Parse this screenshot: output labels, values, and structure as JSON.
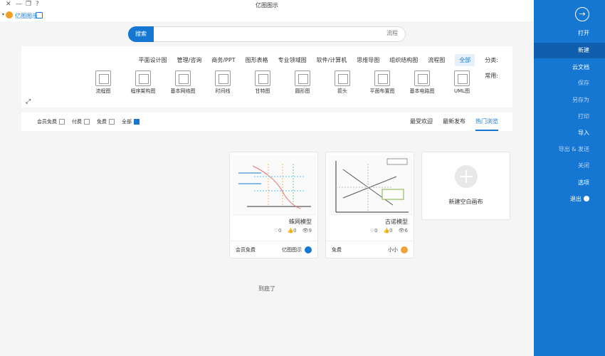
{
  "window": {
    "title": "亿图图示",
    "controls": [
      "✕",
      "—",
      "❐",
      "?"
    ]
  },
  "appbar": {
    "name": "亿图图示"
  },
  "search": {
    "button": "搜索",
    "placeholder": "流程"
  },
  "categories": {
    "label": "分类:",
    "items": [
      "全部",
      "流程图",
      "组织结构图",
      "思维导图",
      "软件/计算机",
      "专业领域图",
      "图形表格",
      "商务/PPT",
      "管理/咨询",
      "平面设计图"
    ],
    "active": 0
  },
  "common": {
    "label": "常用:",
    "items": [
      "UML图",
      "基本电路图",
      "平面布置图",
      "箭头",
      "圆形图",
      "甘特图",
      "时间线",
      "基本网络图",
      "程序架构图",
      "流程图"
    ]
  },
  "sort": {
    "tabs": [
      "热门浏览",
      "最新发布",
      "最受欢迎"
    ],
    "active": 0
  },
  "filters": [
    {
      "label": "全部",
      "checked": true
    },
    {
      "label": "免费",
      "checked": false
    },
    {
      "label": "付费",
      "checked": false
    },
    {
      "label": "会员免费",
      "checked": false
    }
  ],
  "new_card": {
    "label": "新建空白画布"
  },
  "cards": [
    {
      "title": "古诺模型",
      "views": "6",
      "likes": "0",
      "favs": "0",
      "author": "小小",
      "price": "免费",
      "badge_color": "#f2a33a"
    },
    {
      "title": "蛛网模型",
      "views": "9",
      "likes": "0",
      "favs": "0",
      "author": "亿图图示",
      "price": "会员免费",
      "badge_color": "#1677d2"
    }
  ],
  "end_text": "到底了",
  "sidebar": {
    "items": [
      "打开",
      "新建",
      "云文档",
      "保存",
      "另存为",
      "打印",
      "导入",
      "导出 & 发送",
      "关闭",
      "选项",
      "退出"
    ],
    "active": 1
  }
}
